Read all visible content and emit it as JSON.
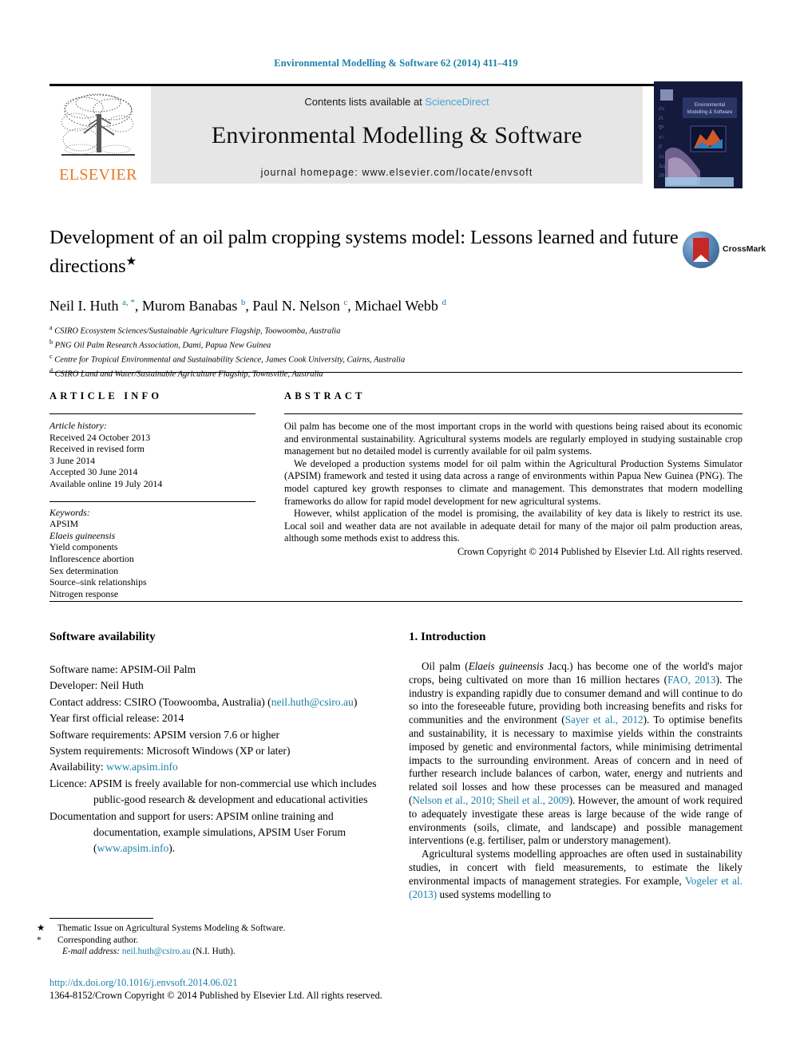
{
  "running_head": "Environmental Modelling & Software 62 (2014) 411–419",
  "banner": {
    "contents_prefix": "Contents lists available at ",
    "sciencedirect": "ScienceDirect",
    "journal_title": "Environmental Modelling & Software",
    "homepage": "journal homepage: www.elsevier.com/locate/envsoft",
    "publisher_logo_text": "ELSEVIER",
    "cover_title": "Environmental Modelling & Software"
  },
  "article": {
    "title": "Development of an oil palm cropping systems model: Lessons learned and future directions",
    "title_symbol": "★",
    "authors_html": "Neil I. Huth <sup class=\"aff-mark\">a, *</sup>, Murom Banabas <sup class=\"aff-mark\">b</sup>, Paul N. Nelson <sup class=\"aff-mark\">c</sup>, Michael Webb <sup class=\"aff-mark\">d</sup>",
    "affiliations": [
      "a CSIRO Ecosystem Sciences/Sustainable Agriculture Flagship, Toowoomba, Australia",
      "b PNG Oil Palm Research Association, Dami, Papua New Guinea",
      "c Centre for Tropical Environmental and Sustainability Science, James Cook University, Cairns, Australia",
      "d CSIRO Land and Water/Sustainable Agriculture Flagship, Townsville, Australia"
    ],
    "affiliations_html": "<sup>a</sup> CSIRO Ecosystem Sciences/Sustainable Agriculture Flagship, Toowoomba, Australia<br><sup>b</sup> PNG Oil Palm Research Association, Dami, Papua New Guinea<br><sup>c</sup> Centre for Tropical Environmental and Sustainability Science, James Cook University, Cairns, Australia<br><sup>d</sup> CSIRO Land and Water/Sustainable Agriculture Flagship, Townsville, Australia",
    "crossmark_label": "CrossMark"
  },
  "article_info": {
    "heading": "ARTICLE INFO",
    "history_label": "Article history:",
    "history": [
      "Received 24 October 2013",
      "Received in revised form",
      "3 June 2014",
      "Accepted 30 June 2014",
      "Available online 19 July 2014"
    ],
    "keywords_label": "Keywords:",
    "keywords": [
      "APSIM",
      "Elaeis guineensis",
      "Yield components",
      "Inflorescence abortion",
      "Sex determination",
      "Source–sink relationships",
      "Nitrogen response"
    ],
    "keywords_italic_index": 1
  },
  "abstract": {
    "heading": "ABSTRACT",
    "paragraphs": [
      "Oil palm has become one of the most important crops in the world with questions being raised about its economic and environmental sustainability. Agricultural systems models are regularly employed in studying sustainable crop management but no detailed model is currently available for oil palm systems.",
      "We developed a production systems model for oil palm within the Agricultural Production Systems Simulator (APSIM) framework and tested it using data across a range of environments within Papua New Guinea (PNG). The model captured key growth responses to climate and management. This demonstrates that modern modelling frameworks do allow for rapid model development for new agricultural systems.",
      "However, whilst application of the model is promising, the availability of key data is likely to restrict its use. Local soil and weather data are not available in adequate detail for many of the major oil palm production areas, although some methods exist to address this."
    ],
    "copyright": "Crown Copyright © 2014 Published by Elsevier Ltd. All rights reserved."
  },
  "software_availability": {
    "heading": "Software availability",
    "items": [
      {
        "label": "Software name:",
        "value": " APSIM-Oil Palm"
      },
      {
        "label": "Developer:",
        "value": " Neil Huth"
      },
      {
        "label": "Contact address:",
        "value": " CSIRO (Toowoomba, Australia) (",
        "link": "neil.huth@csiro.au",
        "after": ")"
      },
      {
        "label": "Year first official release:",
        "value": " 2014"
      },
      {
        "label": "Software requirements:",
        "value": " APSIM version 7.6 or higher"
      },
      {
        "label": "System requirements:",
        "value": " Microsoft Windows (XP or later)"
      },
      {
        "label": "Availability:",
        "value": " ",
        "link": "www.apsim.info",
        "after": ""
      },
      {
        "label": "Licence:",
        "value": " APSIM is freely available for non-commercial use which includes public-good research & development and educational activities"
      },
      {
        "label": "Documentation and support for users:",
        "value": " APSIM online training and documentation, example simulations, APSIM User Forum (",
        "link": "www.apsim.info",
        "after": ")."
      }
    ],
    "contact_email": "neil.huth@csiro.au",
    "availability_url": "www.apsim.info"
  },
  "introduction": {
    "heading": "1. Introduction",
    "paragraph_1_html": "Oil palm (<span class=\"ital\">Elaeis guineensis</span> Jacq.) has become one of the world's major crops, being cultivated on more than 16 million hectares (<span class=\"link\">FAO, 2013</span>). The industry is expanding rapidly due to consumer demand and will continue to do so into the foreseeable future, providing both increasing benefits and risks for communities and the environment (<span class=\"link\">Sayer et al., 2012</span>). To optimise benefits and sustainability, it is necessary to maximise yields within the constraints imposed by genetic and environmental factors, while minimising detrimental impacts to the surrounding environment. Areas of concern and in need of further research include balances of carbon, water, energy and nutrients and related soil losses and how these processes can be measured and managed (<span class=\"link\">Nelson et al., 2010; Sheil et al., 2009</span>). However, the amount of work required to adequately investigate these areas is large because of the wide range of environments (soils, climate, and landscape) and possible management interventions (e.g. fertiliser, palm or understory management).",
    "paragraph_2_html": "Agricultural systems modelling approaches are often used in sustainability studies, in concert with field measurements, to estimate the likely environmental impacts of management strategies. For example, <span class=\"link\">Vogeler et al. (2013)</span> used systems modelling to",
    "citations": [
      "FAO, 2013",
      "Sayer et al., 2012",
      "Nelson et al., 2010; Sheil et al., 2009",
      "Vogeler et al. (2013)"
    ]
  },
  "footnotes": {
    "thematic": "Thematic Issue on Agricultural Systems Modeling & Software.",
    "thematic_mark": "★",
    "corresponding": "Corresponding author.",
    "corresponding_mark": "*",
    "email_label": "E-mail address:",
    "email": "neil.huth@csiro.au",
    "email_owner": "(N.I. Huth)."
  },
  "footer": {
    "doi": "http://dx.doi.org/10.1016/j.envsoft.2014.06.021",
    "issn_line": "1364-8152/Crown Copyright © 2014 Published by Elsevier Ltd. All rights reserved."
  },
  "colors": {
    "link": "#1b7fa8",
    "sciencedirect": "#4aa3d6",
    "elsevier_orange": "#e87722",
    "banner_bg": "#e6e6e6",
    "cover_bg": "#131a3c"
  }
}
